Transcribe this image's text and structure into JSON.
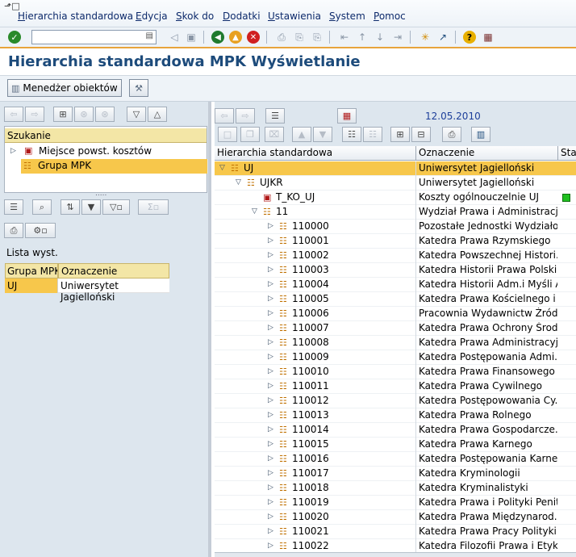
{
  "menu": {
    "items": [
      "Hierarchia standardowa",
      "Edycja",
      "Skok do",
      "Dodatki",
      "Ustawienia",
      "System",
      "Pomoc"
    ]
  },
  "title": "Hierarchia standardowa MPK Wyświetlanie",
  "app_toolbar": {
    "object_manager": "Menedżer obiektów"
  },
  "left": {
    "search_header": "Szukanie",
    "tree": [
      {
        "label": "Miejsce powst. kosztów",
        "icon": "cost-center-icon"
      },
      {
        "label": "Grupa MPK",
        "icon": "org-hierarchy-icon",
        "selected": true
      }
    ],
    "list_title": "Lista wyst.",
    "list_columns": [
      "Grupa MPK",
      "Oznaczenie"
    ],
    "list_rows": [
      {
        "group": "UJ",
        "desc": "Uniwersytet Jagielloński"
      }
    ]
  },
  "right": {
    "date": "12.05.2010",
    "columns": [
      "Hierarchia standardowa",
      "Oznaczenie",
      "Staf"
    ],
    "rows": [
      {
        "node": "UJ",
        "desc": "Uniwersytet Jagielloński",
        "level": 0,
        "icon": "org",
        "expanded": true,
        "selected": true
      },
      {
        "node": "UJKR",
        "desc": "Uniwersytet Jagielloński",
        "level": 1,
        "icon": "org",
        "expanded": true
      },
      {
        "node": "T_KO_UJ",
        "desc": "Koszty ogólnouczelnie UJ",
        "level": 2,
        "icon": "cost",
        "status": "green"
      },
      {
        "node": "11",
        "desc": "Wydział Prawa i Administracji",
        "level": 2,
        "icon": "org",
        "expanded": true
      },
      {
        "node": "110000",
        "desc": "Pozostałe Jednostki Wydziało...",
        "level": 3,
        "icon": "org"
      },
      {
        "node": "110001",
        "desc": "Katedra Prawa Rzymskiego",
        "level": 3,
        "icon": "org"
      },
      {
        "node": "110002",
        "desc": "Katedra Powszechnej Histori...",
        "level": 3,
        "icon": "org"
      },
      {
        "node": "110003",
        "desc": "Katedra Historii Prawa Polski...",
        "level": 3,
        "icon": "org"
      },
      {
        "node": "110004",
        "desc": "Katedra Historii Adm.i Myśli A...",
        "level": 3,
        "icon": "org"
      },
      {
        "node": "110005",
        "desc": "Katedra Prawa Kościelnego i ...",
        "level": 3,
        "icon": "org"
      },
      {
        "node": "110006",
        "desc": "Pracownia Wydawnictw Źródł...",
        "level": 3,
        "icon": "org"
      },
      {
        "node": "110007",
        "desc": "Katedra Prawa Ochrony Środ...",
        "level": 3,
        "icon": "org"
      },
      {
        "node": "110008",
        "desc": "Katedra Prawa Administracyj...",
        "level": 3,
        "icon": "org"
      },
      {
        "node": "110009",
        "desc": "Katedra Postępowania Admi...",
        "level": 3,
        "icon": "org"
      },
      {
        "node": "110010",
        "desc": "Katedra Prawa Finansowego",
        "level": 3,
        "icon": "org"
      },
      {
        "node": "110011",
        "desc": "Katedra Prawa Cywilnego",
        "level": 3,
        "icon": "org"
      },
      {
        "node": "110012",
        "desc": "Katedra Postępowowania Cy...",
        "level": 3,
        "icon": "org"
      },
      {
        "node": "110013",
        "desc": "Katedra Prawa Rolnego",
        "level": 3,
        "icon": "org"
      },
      {
        "node": "110014",
        "desc": "Katedra Prawa Gospodarcze...",
        "level": 3,
        "icon": "org"
      },
      {
        "node": "110015",
        "desc": "Katedra Prawa Karnego",
        "level": 3,
        "icon": "org"
      },
      {
        "node": "110016",
        "desc": "Katedra Postępowania Karne...",
        "level": 3,
        "icon": "org"
      },
      {
        "node": "110017",
        "desc": "Katedra Kryminologii",
        "level": 3,
        "icon": "org"
      },
      {
        "node": "110018",
        "desc": "Katedra Kryminalistyki",
        "level": 3,
        "icon": "org"
      },
      {
        "node": "110019",
        "desc": "Katedra Prawa i Polityki Penit...",
        "level": 3,
        "icon": "org"
      },
      {
        "node": "110020",
        "desc": "Katedra Prawa Międzynarod. ...",
        "level": 3,
        "icon": "org"
      },
      {
        "node": "110021",
        "desc": "Katedra Prawa Pracy Polityki ...",
        "level": 3,
        "icon": "org"
      },
      {
        "node": "110022",
        "desc": "Katedra Filozofii Prawa i Etyki ...",
        "level": 3,
        "icon": "org"
      }
    ]
  }
}
